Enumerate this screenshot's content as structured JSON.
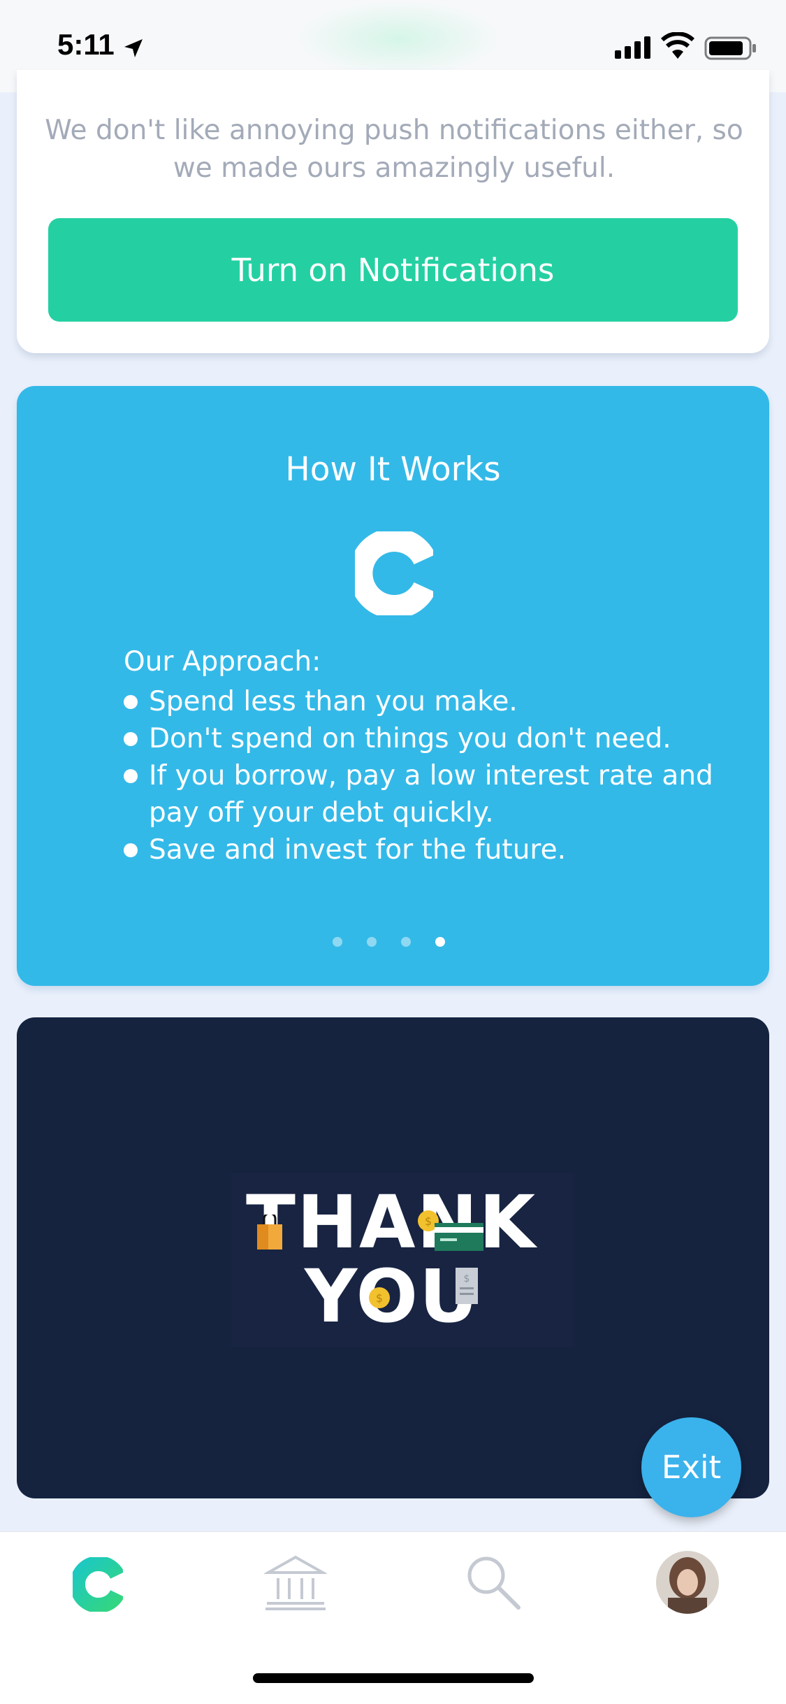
{
  "status_bar": {
    "time": "5:11"
  },
  "notification_card": {
    "description": "We don't like annoying push notifications either, so we made ours amazingly useful.",
    "button_label": "Turn on Notifications"
  },
  "how_it_works": {
    "title": "How It Works",
    "approach_heading": "Our Approach:",
    "approach_items": [
      "Spend less than you make.",
      "Don't spend on things you don't need.",
      "If you borrow, pay a low interest rate and pay off your debt quickly.",
      "Save and invest for the future."
    ],
    "carousel": {
      "page_count": 4,
      "active_index": 3
    }
  },
  "thank_you_card": {
    "image_text_line1": "THANK",
    "image_text_line2": "YOU"
  },
  "exit_button": {
    "label": "Exit"
  },
  "tab_bar": {
    "tabs": [
      {
        "icon": "clarity-logo-icon",
        "active": true
      },
      {
        "icon": "bank-icon",
        "active": false
      },
      {
        "icon": "search-icon",
        "active": false
      },
      {
        "icon": "profile-avatar",
        "active": false
      }
    ]
  },
  "colors": {
    "accent_green": "#24d0a2",
    "card_blue": "#33b9e8",
    "card_navy": "#15233f",
    "exit_blue": "#3ab2ec",
    "page_background": "#eaf0fb"
  }
}
